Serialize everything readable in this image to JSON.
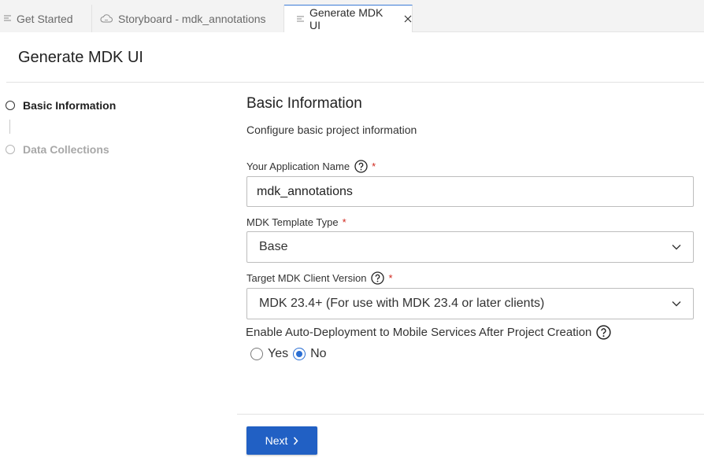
{
  "tabs": [
    {
      "label": "Get Started",
      "icon": "lines-icon"
    },
    {
      "label": "Storyboard - mdk_annotations",
      "icon": "cloud-icon"
    },
    {
      "label": "Generate MDK UI",
      "icon": "lines-icon",
      "active": true
    }
  ],
  "page": {
    "title": "Generate MDK UI"
  },
  "steps": [
    {
      "label": "Basic Information",
      "active": true
    },
    {
      "label": "Data Collections",
      "active": false
    }
  ],
  "form": {
    "title": "Basic Information",
    "subtitle": "Configure basic project information",
    "app_name": {
      "label": "Your Application Name",
      "required": "*",
      "value": "mdk_annotations"
    },
    "template_type": {
      "label": "MDK Template Type",
      "required": "*",
      "value": "Base"
    },
    "client_version": {
      "label": "Target MDK Client Version",
      "required": "*",
      "value": "MDK 23.4+ (For use with MDK 23.4 or later clients)"
    },
    "auto_deploy": {
      "label": "Enable Auto-Deployment to Mobile Services After Project Creation",
      "options": [
        {
          "label": "Yes",
          "checked": false
        },
        {
          "label": "No",
          "checked": true
        }
      ]
    }
  },
  "footer": {
    "next_label": "Next"
  },
  "colors": {
    "primary": "#2160c4",
    "required": "#d0271d",
    "active_tab_border": "#3b7bd6"
  }
}
